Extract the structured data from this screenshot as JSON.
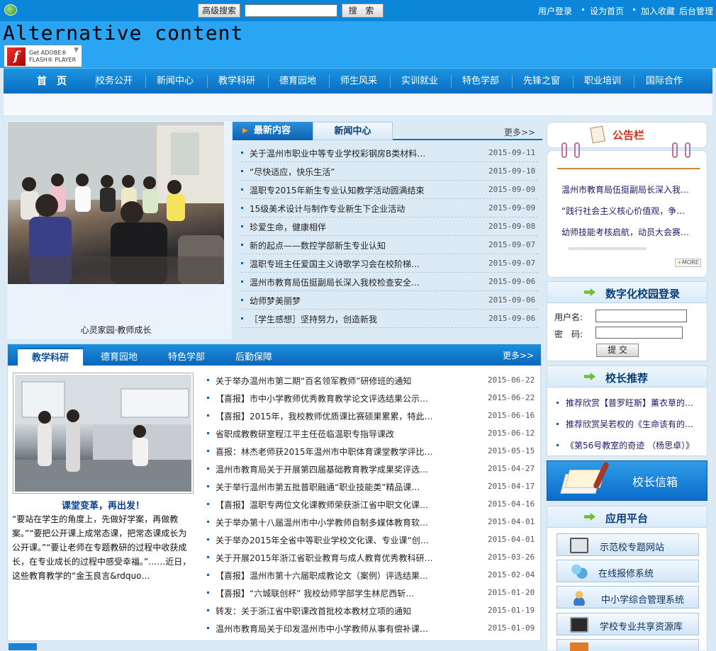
{
  "topbar": {
    "advanced_search": "高级搜索",
    "search_placeholder": "",
    "search_button": "搜 索",
    "links": [
      "用户登录",
      "设为首页",
      "加入收藏",
      "后台管理"
    ]
  },
  "banner": {
    "alt_content": "Alternative content",
    "flash_line1": "Get ADOBE®",
    "flash_line2": "FLASH® PLAYER",
    "flash_glyph": "f"
  },
  "nav": {
    "items": [
      "首　页",
      "校务公开",
      "新闻中心",
      "教学科研",
      "德育园地",
      "师生风采",
      "实训就业",
      "特色学部",
      "先锋之窗",
      "职业培训",
      "国际合作"
    ]
  },
  "photo_block": {
    "caption": "心灵家园·教师成长"
  },
  "news_panel": {
    "tab_active": "最新内容",
    "tab_inactive": "新闻中心",
    "more": "更多>>",
    "items": [
      {
        "title": "关于温州市职业中等专业学校彩钢房B类材料…",
        "date": "2015-09-11"
      },
      {
        "title": "“尽快适应，快乐生活”",
        "date": "2015-09-10"
      },
      {
        "title": "温职专2015年新生专业认知教学活动圆满结束",
        "date": "2015-09-09"
      },
      {
        "title": "15级美术设计与制作专业新生下企业活动",
        "date": "2015-09-09"
      },
      {
        "title": "珍爱生命，健康相伴",
        "date": "2015-09-08"
      },
      {
        "title": "新的起点——数控学部新生专业认知",
        "date": "2015-09-07"
      },
      {
        "title": "温职专班主任爱国主义诗歌学习会在校阶梯…",
        "date": "2015-09-07"
      },
      {
        "title": "温州市教育局伍挺副局长深入我校检查安全…",
        "date": "2015-09-06"
      },
      {
        "title": "幼师梦美丽梦",
        "date": "2015-09-06"
      },
      {
        "title": "［学生感想］坚持努力，创造新我",
        "date": "2015-09-06"
      }
    ]
  },
  "notice": {
    "title": "公告栏",
    "items": [
      "温州市教育局伍挺副局长深入我…",
      "“践行社会主义核心价值观，争…",
      "幼师技能考核启航，动员大会赛…"
    ],
    "more": "MORE"
  },
  "login": {
    "title": "数字化校园登录",
    "username_label": "用户名:",
    "password_label": "密　码:",
    "submit": "提 交"
  },
  "principal": {
    "title": "校长推荐",
    "items": [
      "推荐欣赏【普罗旺斯】薰衣草的…",
      "推荐欣赏吴若权的《生命该有的…",
      "《第56号教室的奇迹 （杨思卓）》"
    ]
  },
  "mailbox": {
    "label": "校长信箱"
  },
  "apps": {
    "title": "应用平台",
    "items": [
      "示范校专题网站",
      "在线报修系统",
      "中小学综合管理系统",
      "学校专业共享资源库"
    ]
  },
  "bottom_panel": {
    "tabs": [
      "教学科研",
      "德育园地",
      "特色学部",
      "后勤保障"
    ],
    "more": "更多>>",
    "feature_title": "课堂变革，再出发！",
    "feature_text": "“要站在学生的角度上，先做好学案，再做教案。”“要把公开课上成常态课，把常态课成长为公开课。”“要让老师在专题教研的过程中收获成长，在专业成长的过程中感受幸福。”……近日，这些教育教学的“金玉良言&rdquo…",
    "items": [
      {
        "title": "关于举办温州市第二期“百名领军教师”研修班的通知",
        "date": "2015-06-22"
      },
      {
        "title": "【喜报】市中小学教师优秀教育教学论文评选结果公示…",
        "date": "2015-06-22"
      },
      {
        "title": "【喜报】2015年，我校教师优质课比赛硕果累累，特此…",
        "date": "2015-06-16"
      },
      {
        "title": "省职成教教研室程江平主任莅临温职专指导课改",
        "date": "2015-06-12"
      },
      {
        "title": "喜报：林杰老师获2015年温州市中职体育课堂教学评比…",
        "date": "2015-05-15"
      },
      {
        "title": "温州市教育局关于开展第四届基础教育教学成果奖评选…",
        "date": "2015-04-27"
      },
      {
        "title": "关于举行温州市第五批普职融通“职业技能类”精品课…",
        "date": "2015-04-17"
      },
      {
        "title": "【喜报】温职专两位文化课教师荣获浙江省中职文化课…",
        "date": "2015-04-16"
      },
      {
        "title": "关于举办第十八届温州市中小学教师自制多媒体教育软…",
        "date": "2015-04-01"
      },
      {
        "title": "关于举办2015年全省中等职业学校文化课、专业课“创…",
        "date": "2015-04-01"
      },
      {
        "title": "关于开展2015年浙江省职业教育与成人教育优秀教科研…",
        "date": "2015-03-26"
      },
      {
        "title": "【喜报】温州市第十六届职成教论文（案例）评选结果…",
        "date": "2015-02-04"
      },
      {
        "title": "【喜报】“六城联创杯” 我校幼师学部学生林尼西斩…",
        "date": "2015-01-20"
      },
      {
        "title": "转发：关于浙江省中职课改首批校本教材立项的通知",
        "date": "2015-01-19"
      },
      {
        "title": "温州市教育局关于印发温州市中小学教师从事有偿补课…",
        "date": "2015-01-09"
      }
    ]
  }
}
